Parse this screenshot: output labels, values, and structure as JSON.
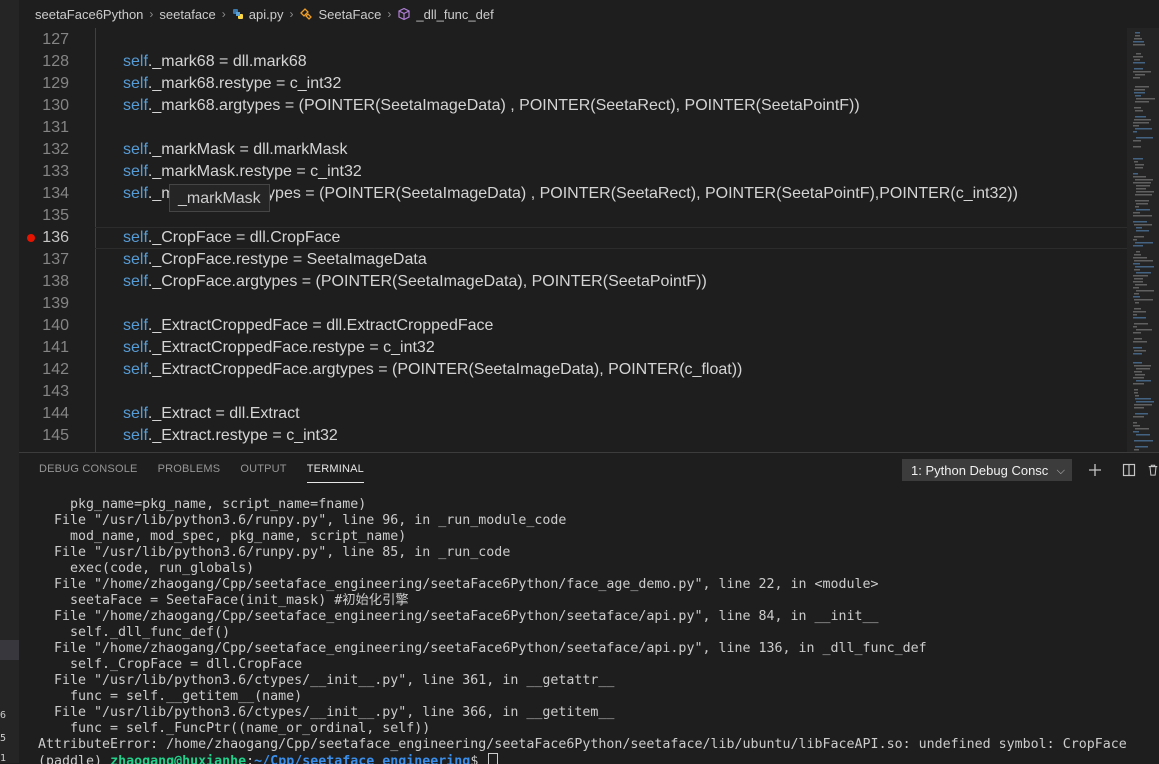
{
  "breadcrumb": {
    "items": [
      "seetaFace6Python",
      "seetaface",
      "api.py",
      "SeetaFace",
      "_dll_func_def"
    ]
  },
  "editor": {
    "lines": [
      {
        "n": "127",
        "self": "",
        "rest": ""
      },
      {
        "n": "128",
        "self": "self",
        "rest": "._mark68 = dll.mark68"
      },
      {
        "n": "129",
        "self": "self",
        "rest": "._mark68.restype = c_int32"
      },
      {
        "n": "130",
        "self": "self",
        "rest": "._mark68.argtypes = (POINTER(SeetaImageData) , POINTER(SeetaRect), POINTER(SeetaPointF))"
      },
      {
        "n": "131",
        "self": "",
        "rest": ""
      },
      {
        "n": "132",
        "self": "self",
        "rest": "._markMask = dll.markMask"
      },
      {
        "n": "133",
        "self": "self",
        "rest": "._markMask.restype = c_int32"
      },
      {
        "n": "134",
        "self": "self",
        "rest": "._markMask.argtypes = (POINTER(SeetaImageData) , POINTER(SeetaRect), POINTER(SeetaPointF),POINTER(c_int32))"
      },
      {
        "n": "135",
        "self": "",
        "rest": ""
      },
      {
        "n": "136",
        "self": "self",
        "rest": "._CropFace = dll.CropFace"
      },
      {
        "n": "137",
        "self": "self",
        "rest": "._CropFace.restype = SeetaImageData"
      },
      {
        "n": "138",
        "self": "self",
        "rest": "._CropFace.argtypes = (POINTER(SeetaImageData), POINTER(SeetaPointF))"
      },
      {
        "n": "139",
        "self": "",
        "rest": ""
      },
      {
        "n": "140",
        "self": "self",
        "rest": "._ExtractCroppedFace = dll.ExtractCroppedFace"
      },
      {
        "n": "141",
        "self": "self",
        "rest": "._ExtractCroppedFace.restype = c_int32"
      },
      {
        "n": "142",
        "self": "self",
        "rest": "._ExtractCroppedFace.argtypes = (POINTER(SeetaImageData), POINTER(c_float))"
      },
      {
        "n": "143",
        "self": "",
        "rest": ""
      },
      {
        "n": "144",
        "self": "self",
        "rest": "._Extract = dll.Extract"
      },
      {
        "n": "145",
        "self": "self",
        "rest": "._Extract.restype = c_int32"
      }
    ],
    "breakpoint_line": "136",
    "hover_text": "_markMask"
  },
  "panel": {
    "tabs": [
      "DEBUG CONSOLE",
      "PROBLEMS",
      "OUTPUT",
      "TERMINAL"
    ],
    "active_tab": "TERMINAL",
    "terminal_select": "1: Python Debug Consc"
  },
  "terminal": {
    "lines": [
      "    pkg_name=pkg_name, script_name=fname)",
      "  File \"/usr/lib/python3.6/runpy.py\", line 96, in _run_module_code",
      "    mod_name, mod_spec, pkg_name, script_name)",
      "  File \"/usr/lib/python3.6/runpy.py\", line 85, in _run_code",
      "    exec(code, run_globals)",
      "  File \"/home/zhaogang/Cpp/seetaface_engineering/seetaFace6Python/face_age_demo.py\", line 22, in <module>",
      "    seetaFace = SeetaFace(init_mask) #初始化引擎",
      "  File \"/home/zhaogang/Cpp/seetaface_engineering/seetaFace6Python/seetaface/api.py\", line 84, in __init__",
      "    self._dll_func_def()",
      "  File \"/home/zhaogang/Cpp/seetaface_engineering/seetaFace6Python/seetaface/api.py\", line 136, in _dll_func_def",
      "    self._CropFace = dll.CropFace",
      "  File \"/usr/lib/python3.6/ctypes/__init__.py\", line 361, in __getattr__",
      "    func = self.__getitem__(name)",
      "  File \"/usr/lib/python3.6/ctypes/__init__.py\", line 366, in __getitem__",
      "    func = self._FuncPtr((name_or_ordinal, self))",
      "AttributeError: /home/zhaogang/Cpp/seetaface_engineering/seetaFace6Python/seetaface/lib/ubuntu/libFaceAPI.so: undefined symbol: CropFace"
    ],
    "prompt": {
      "env": "(paddle) ",
      "user": "zhaogang@huxianhe",
      "colon": ":",
      "path": "~/Cpp/seetaface_engineering",
      "dollar": "$ "
    }
  },
  "strip": {
    "numbers": [
      "6",
      "5",
      "1"
    ]
  }
}
